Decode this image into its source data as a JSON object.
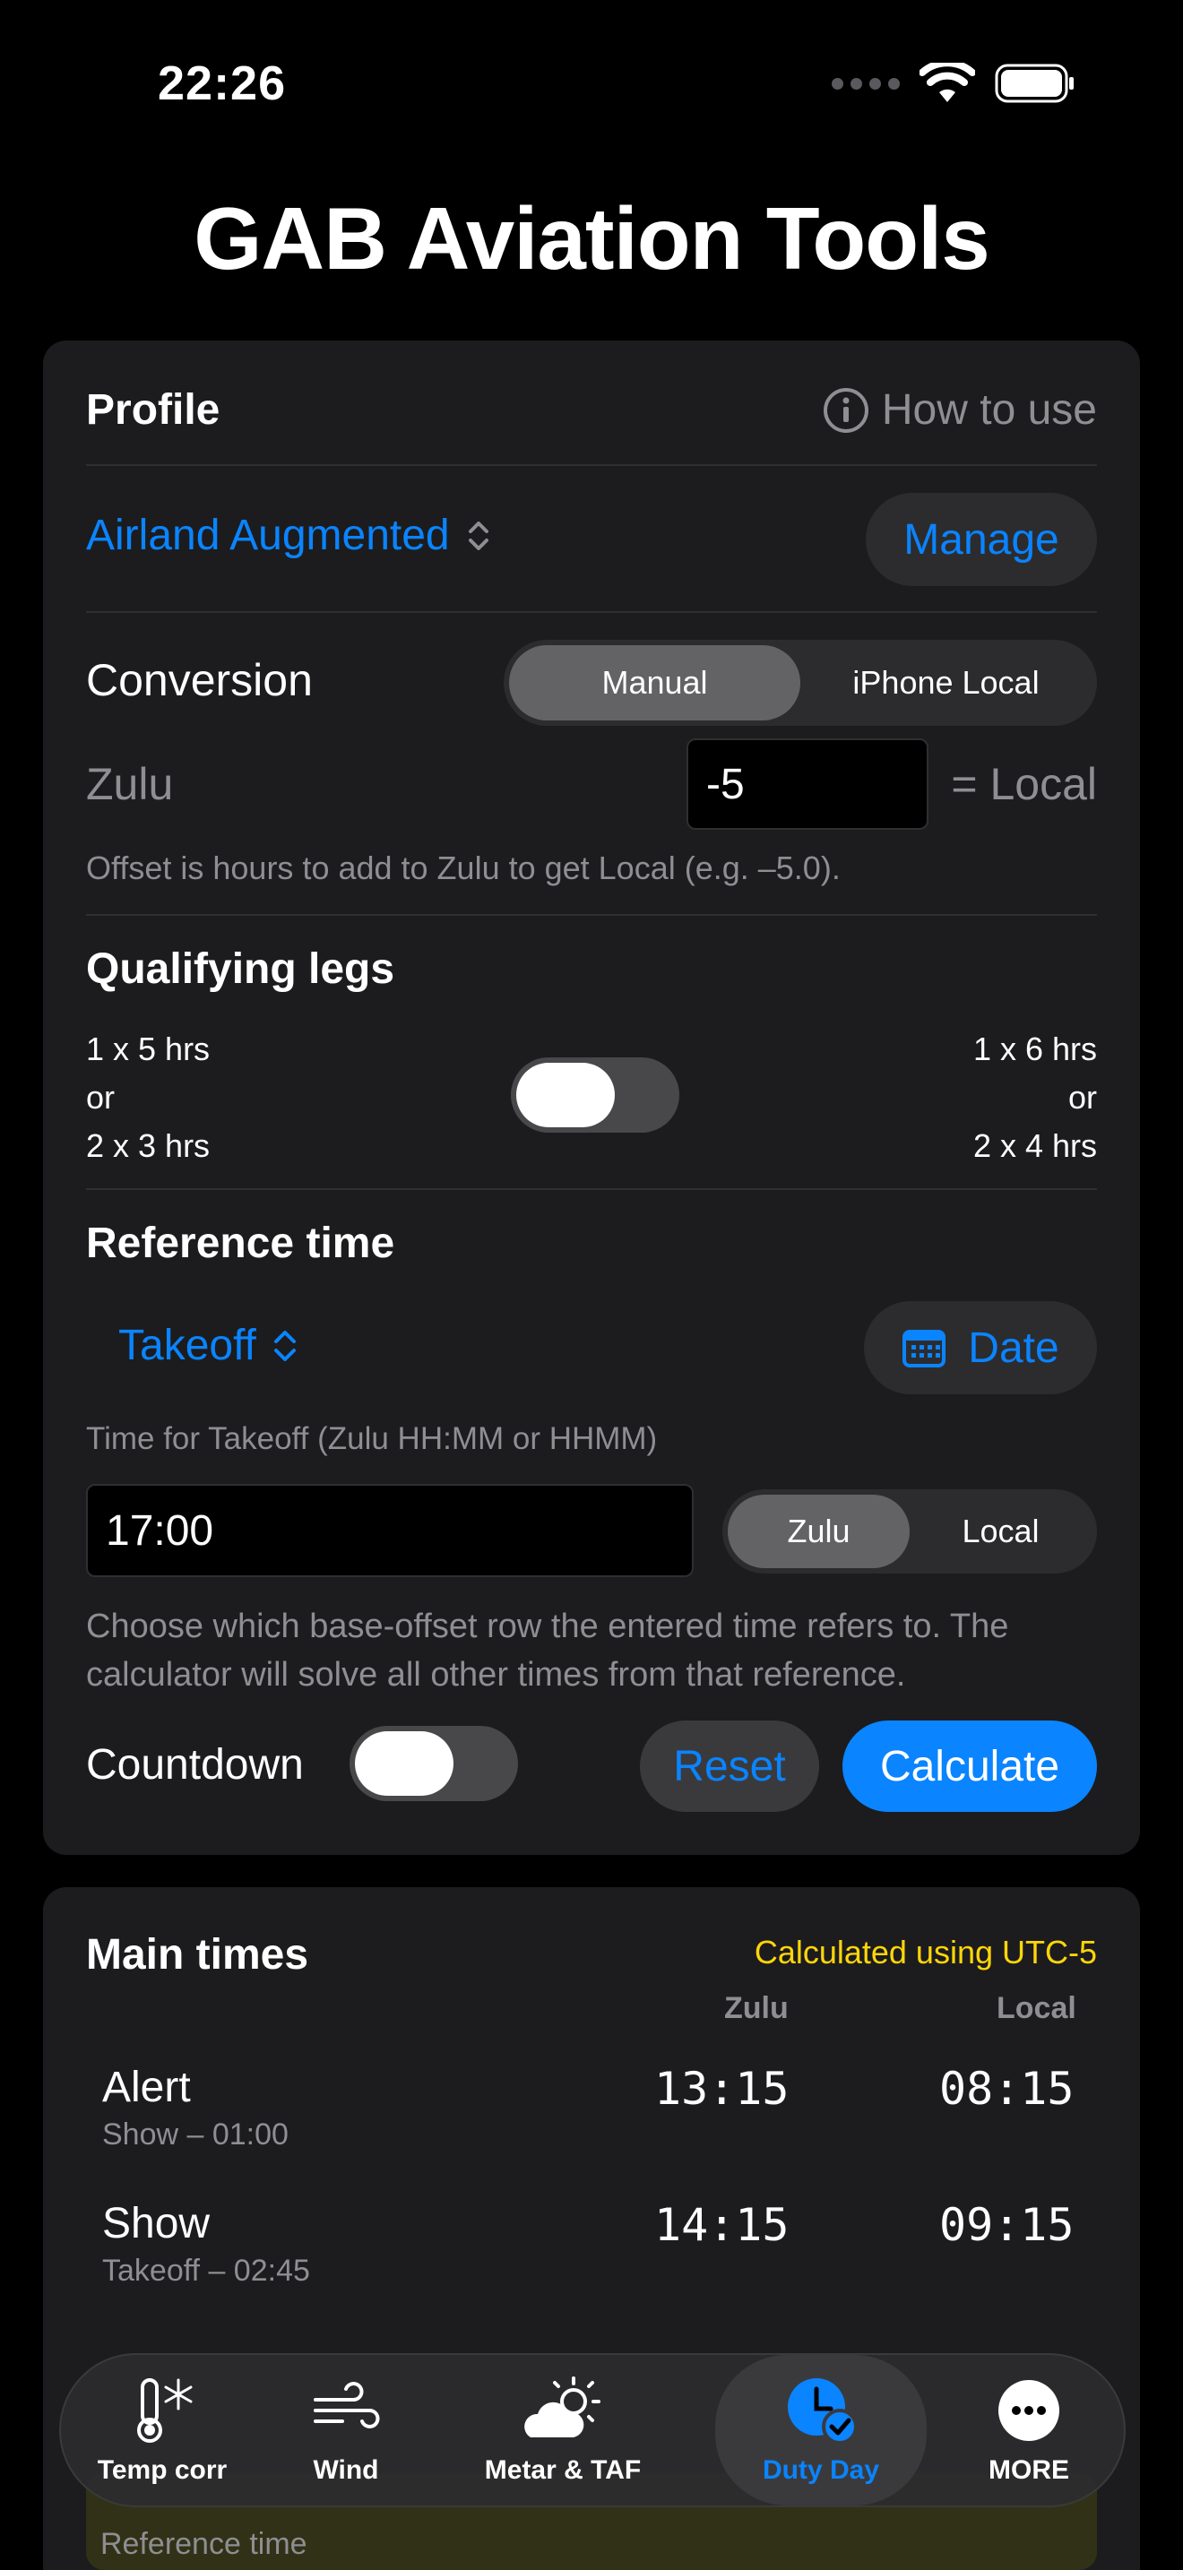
{
  "status": {
    "time": "22:26"
  },
  "app_title": "GAB Aviation Tools",
  "profile": {
    "heading": "Profile",
    "how_to_use": "How to use",
    "selected_profile": "Airland Augmented",
    "manage_label": "Manage"
  },
  "conversion": {
    "label": "Conversion",
    "options": [
      "Manual",
      "iPhone Local"
    ],
    "selected": "Manual",
    "zulu_label": "Zulu",
    "offset_value": "-5",
    "equals_local": "= Local",
    "hint": "Offset is hours to add to Zulu to get Local (e.g. –5.0)."
  },
  "qualifying_legs": {
    "heading": "Qualifying legs",
    "left": [
      "1 x 5 hrs",
      "or",
      "2 x 3 hrs"
    ],
    "right": [
      "1 x 6 hrs",
      "or",
      "2 x 4 hrs"
    ],
    "toggle_on": false
  },
  "reference_time": {
    "heading": "Reference time",
    "reference": "Takeoff",
    "date_label": "Date",
    "field_label": "Time for Takeoff (Zulu HH:MM or HHMM)",
    "time_value": "17:00",
    "zone_options": [
      "Zulu",
      "Local"
    ],
    "zone_selected": "Zulu",
    "hint_line1": "Choose which base-offset row the entered time refers to. The",
    "hint_line2": "calculator will solve all other times from that reference.",
    "countdown_label": "Countdown",
    "countdown_on": false,
    "reset_label": "Reset",
    "calculate_label": "Calculate"
  },
  "main_times": {
    "heading": "Main times",
    "calc_note": "Calculated using UTC-5",
    "col_zulu": "Zulu",
    "col_local": "Local",
    "rows": [
      {
        "name": "Alert",
        "sub": "Show – 01:00",
        "zulu": "13:15",
        "local": "08:15"
      },
      {
        "name": "Show",
        "sub": "Takeoff – 02:45",
        "zulu": "14:15",
        "local": "09:15"
      }
    ],
    "peek_text": "Reference time"
  },
  "colors": {
    "accent": "#0a84ff",
    "warning": "#ffd60a",
    "card": "#1c1c1e"
  },
  "tabs": [
    {
      "label": "Temp corr",
      "icon": "thermometer-snowflake-icon"
    },
    {
      "label": "Wind",
      "icon": "wind-icon"
    },
    {
      "label": "Metar & TAF",
      "icon": "cloud-sun-icon"
    },
    {
      "label": "Duty Day",
      "icon": "clock-check-icon",
      "active": true
    },
    {
      "label": "MORE",
      "icon": "more-icon"
    }
  ]
}
